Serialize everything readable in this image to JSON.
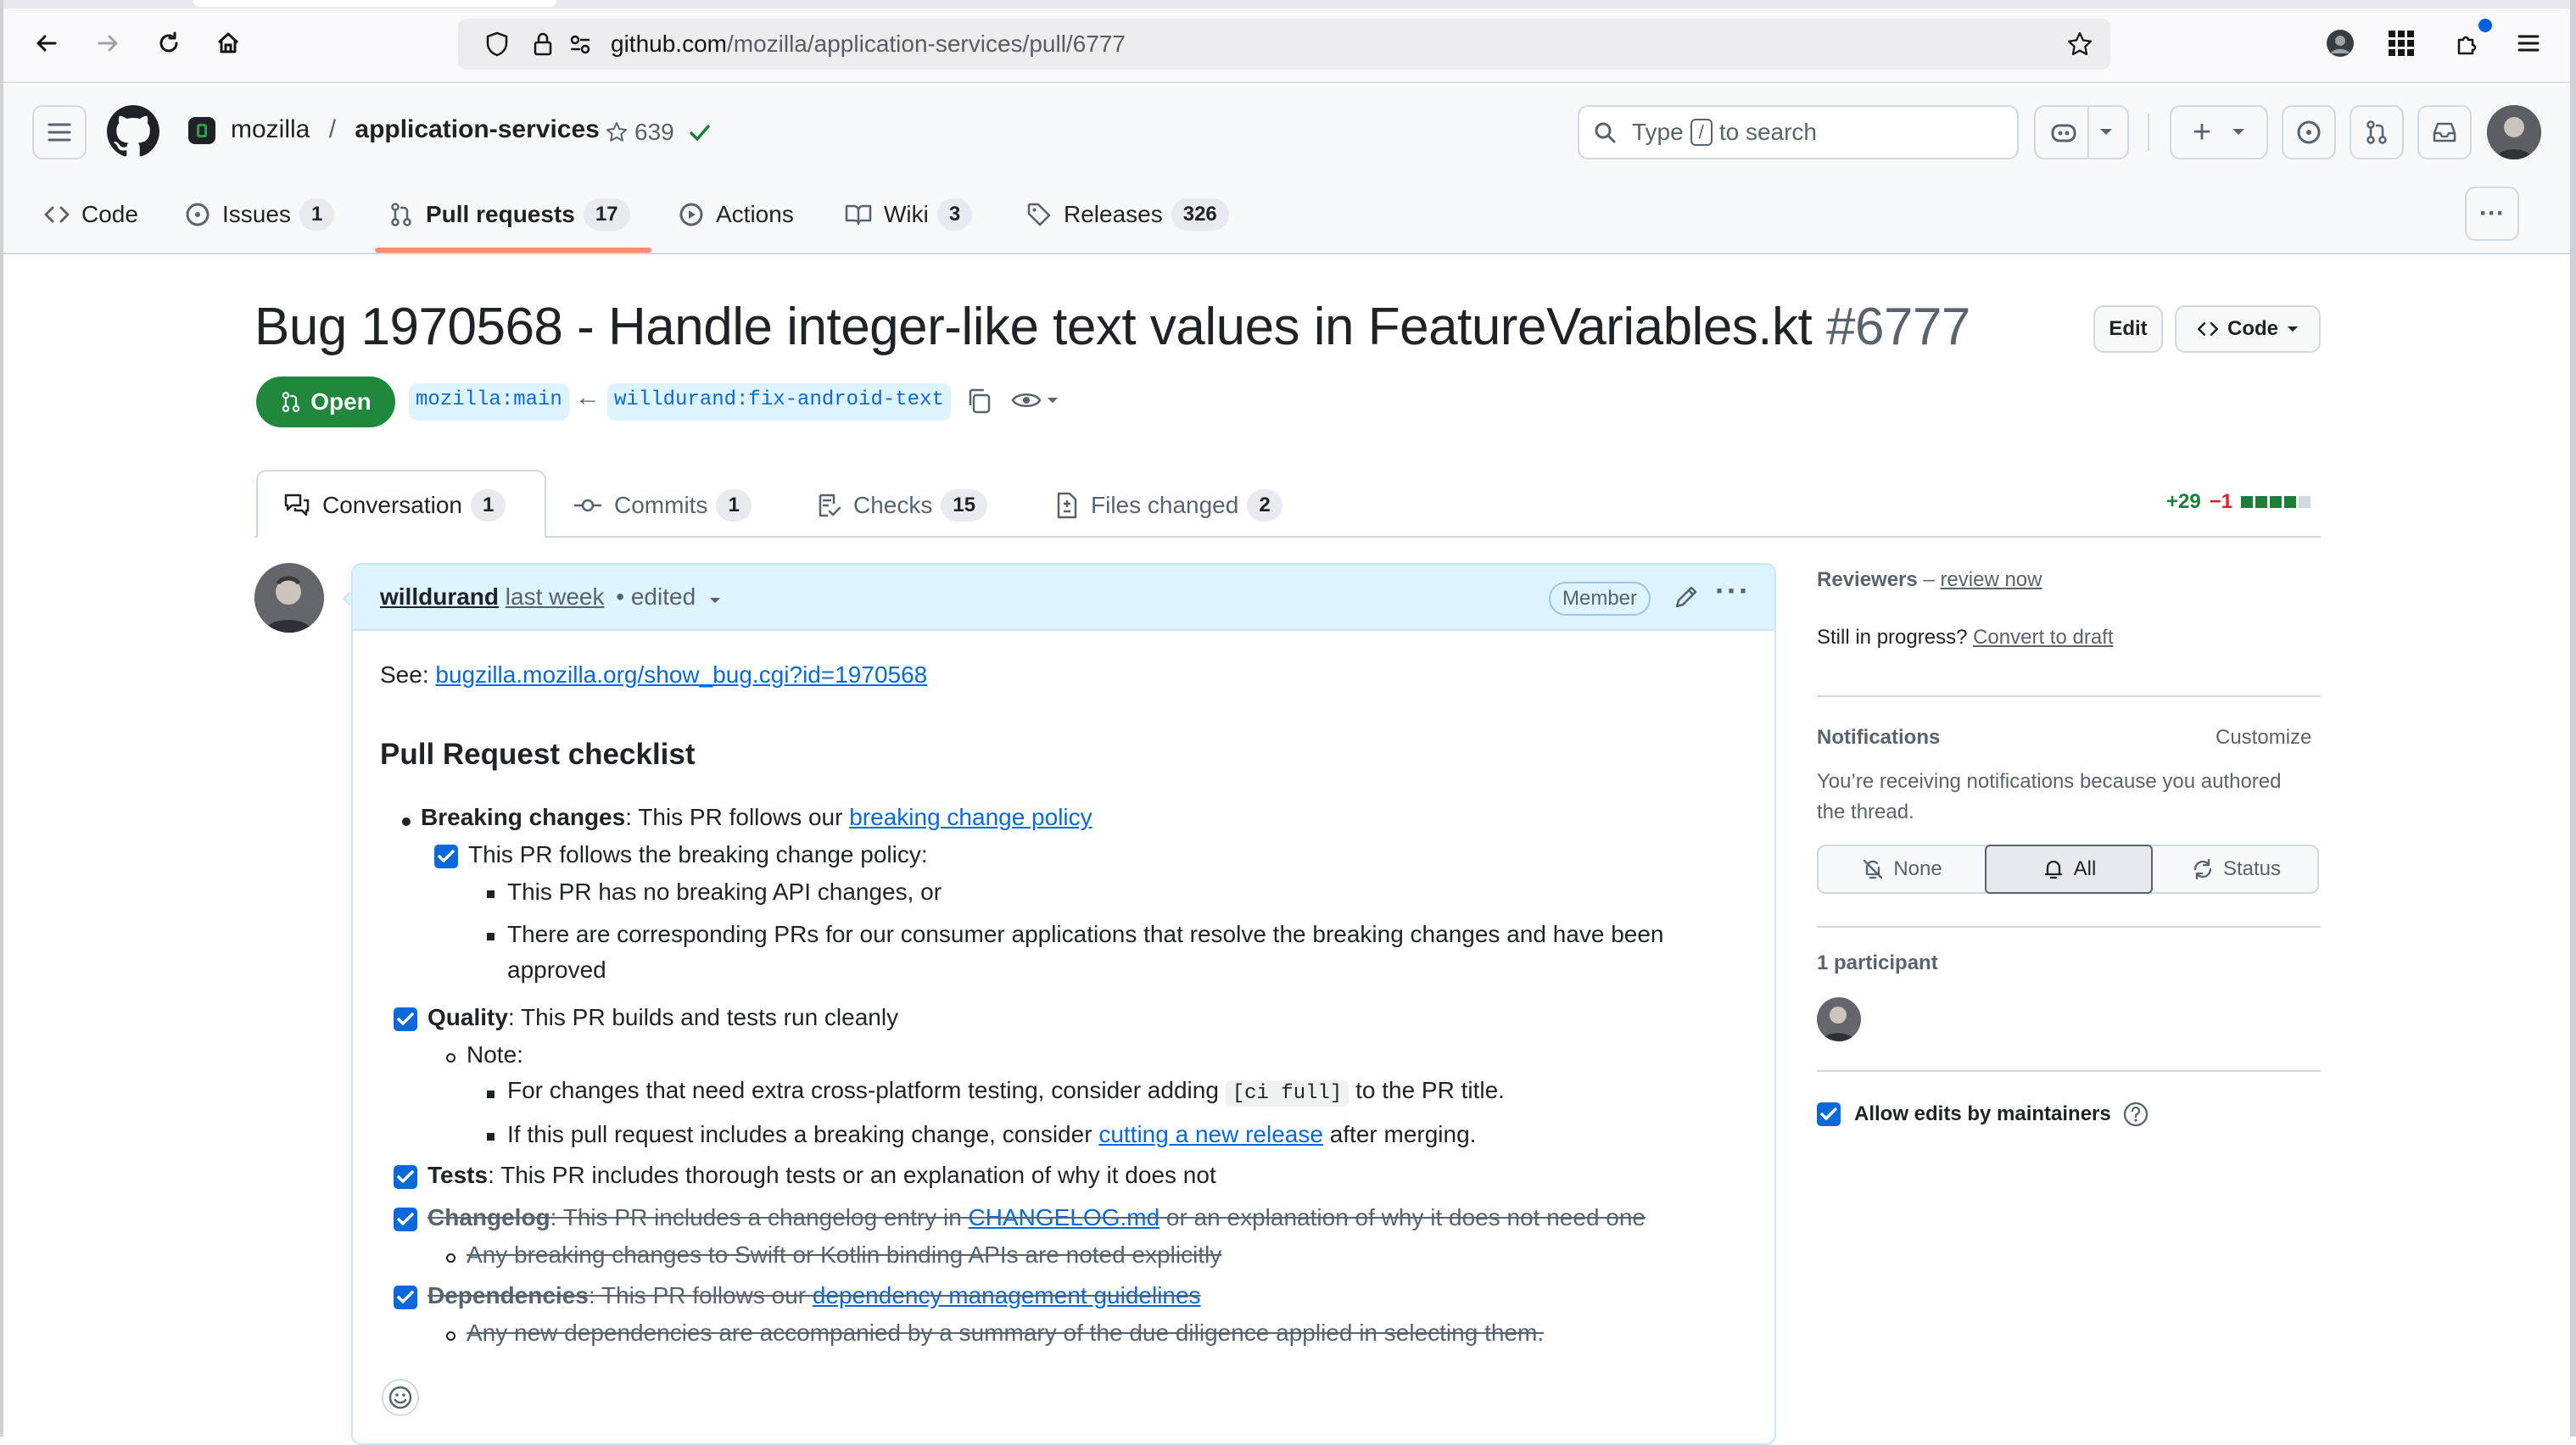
{
  "browser": {
    "url_host": "github.com",
    "url_path": "/mozilla/application-services/pull/6777"
  },
  "header": {
    "owner": "mozilla",
    "separator": "/",
    "repo": "application-services",
    "stars": "639",
    "search_type": "Type",
    "search_key": "/",
    "search_rest": "to search",
    "plus": "+"
  },
  "repo_nav": {
    "code": "Code",
    "issues": "Issues",
    "issues_count": "1",
    "pulls": "Pull requests",
    "pulls_count": "17",
    "actions": "Actions",
    "wiki": "Wiki",
    "wiki_count": "3",
    "releases": "Releases",
    "releases_count": "326",
    "more": "···"
  },
  "pr": {
    "title": "Bug 1970568 - Handle integer-like text values in FeatureVariables.kt",
    "number": "#6777",
    "edit_label": "Edit",
    "code_label": "Code",
    "state": "Open",
    "base_branch": "mozilla:main",
    "head_branch": "willdurand:fix-android-text",
    "arrow": "←"
  },
  "tabs": {
    "conversation": "Conversation",
    "conversation_count": "1",
    "commits": "Commits",
    "commits_count": "1",
    "checks": "Checks",
    "checks_count": "15",
    "files": "Files changed",
    "files_count": "2",
    "additions": "+29",
    "deletions": "−1",
    "diff_blocks": [
      "#1a7f37",
      "#1a7f37",
      "#1a7f37",
      "#1a7f37",
      "#d1d9e0"
    ]
  },
  "comment": {
    "author": "willdurand",
    "time": "last week",
    "edited": "• edited",
    "badge": "Member",
    "see_label": "See:",
    "see_link": "bugzilla.mozilla.org/show_bug.cgi?id=1970568",
    "heading": "Pull Request checklist",
    "breaking_bold": "Breaking changes",
    "breaking_text": ": This PR follows our ",
    "breaking_link": "breaking change policy",
    "breaking_sub": "This PR follows the breaking change policy:",
    "breaking_sub1": "This PR has no breaking API changes, or",
    "breaking_sub2a": "There are corresponding PRs for our consumer applications that resolve the breaking changes and have been",
    "breaking_sub2b": "approved",
    "quality_bold": "Quality",
    "quality_text": ": This PR builds and tests run cleanly",
    "note": "Note:",
    "note1a": "For changes that need extra cross-platform testing, consider adding",
    "note1_code": "[ci full]",
    "note1b": "to the PR title.",
    "note2a": "If this pull request includes a breaking change, consider",
    "note2_link": "cutting a new release",
    "note2b": "after merging.",
    "tests_bold": "Tests",
    "tests_text": ": This PR includes thorough tests or an explanation of why it does not",
    "changelog_bold": "Changelog",
    "changelog_text": ": This PR includes a changelog entry in ",
    "changelog_link": "CHANGELOG.md",
    "changelog_text2": " or an explanation of why it does not need one",
    "changelog_sub": "Any breaking changes to Swift or Kotlin binding APIs are noted explicitly",
    "deps_bold": "Dependencies",
    "deps_text": ": This PR follows our ",
    "deps_link": "dependency management guidelines",
    "deps_sub": "Any new dependencies are accompanied by a summary of the due diligence applied in selecting them."
  },
  "sidebar": {
    "reviewers": "Reviewers",
    "reviewers_dash": " – ",
    "review_now": "review now",
    "in_progress": "Still in progress?",
    "convert": "Convert to draft",
    "notifications": "Notifications",
    "customize": "Customize",
    "notif_text1": "You’re receiving notifications because you authored",
    "notif_text2": "the thread.",
    "none": "None",
    "all": "All",
    "status": "Status",
    "participants": "1 participant",
    "allow_edits": "Allow edits by maintainers"
  }
}
